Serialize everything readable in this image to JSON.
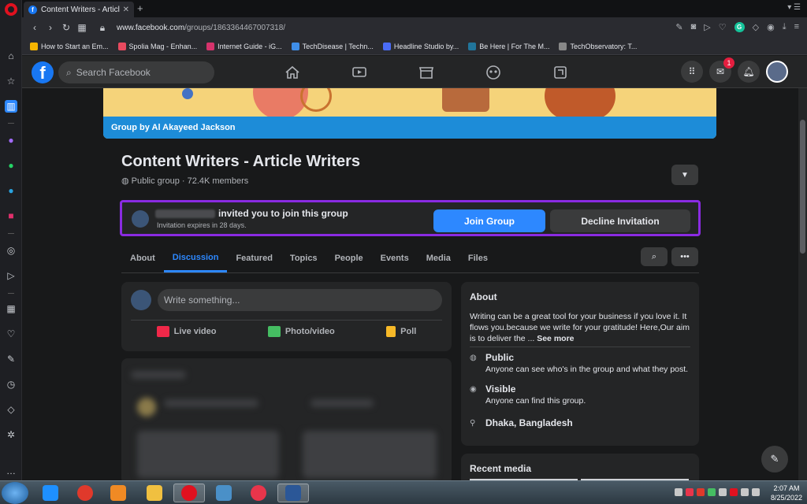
{
  "browser": {
    "tab_title": "Content Writers - Article W",
    "url_domain": "www.facebook.com",
    "url_path": "/groups/1863364467007318/",
    "bookmarks": [
      {
        "label": "How to Start an Em...",
        "color": "#f5b400"
      },
      {
        "label": "Spolia Mag - Enhan...",
        "color": "#e84a5f"
      },
      {
        "label": "Internet Guide - iG...",
        "color": "#d6336c"
      },
      {
        "label": "TechDisease | Techn...",
        "color": "#3f8ee8"
      },
      {
        "label": "Headline Studio by...",
        "color": "#4a6cf7"
      },
      {
        "label": "Be Here | For The M...",
        "color": "#21759b"
      },
      {
        "label": "TechObservatory: T...",
        "color": "#888888"
      }
    ]
  },
  "header": {
    "search_placeholder": "Search Facebook",
    "messenger_badge": "1"
  },
  "group": {
    "cover_caption": "Group by Al Akayeed Jackson",
    "title": "Content Writers - Article Writers",
    "meta": "Public group · 72.4K members"
  },
  "invitation": {
    "text": "invited you to join this group",
    "expires": "Invitation expires in 28 days.",
    "join_label": "Join Group",
    "decline_label": "Decline Invitation"
  },
  "tabs": [
    "About",
    "Discussion",
    "Featured",
    "Topics",
    "People",
    "Events",
    "Media",
    "Files"
  ],
  "composer": {
    "placeholder": "Write something...",
    "actions": [
      {
        "label": "Live video",
        "color": "#f02849"
      },
      {
        "label": "Photo/video",
        "color": "#45bd62"
      },
      {
        "label": "Poll",
        "color": "#f7b928"
      }
    ]
  },
  "about": {
    "heading": "About",
    "description": "Writing can be a great tool for your business if you love it. It flows you.because we write for your gratitude! Here,Our aim is to deliver the ...",
    "see_more": "See more",
    "public_title": "Public",
    "public_sub": "Anyone can see who's in the group and what they post.",
    "visible_title": "Visible",
    "visible_sub": "Anyone can find this group.",
    "location": "Dhaka, Bangladesh"
  },
  "recent_media": {
    "heading": "Recent media"
  },
  "taskbar": {
    "time": "2:07 AM",
    "date": "8/25/2022"
  }
}
